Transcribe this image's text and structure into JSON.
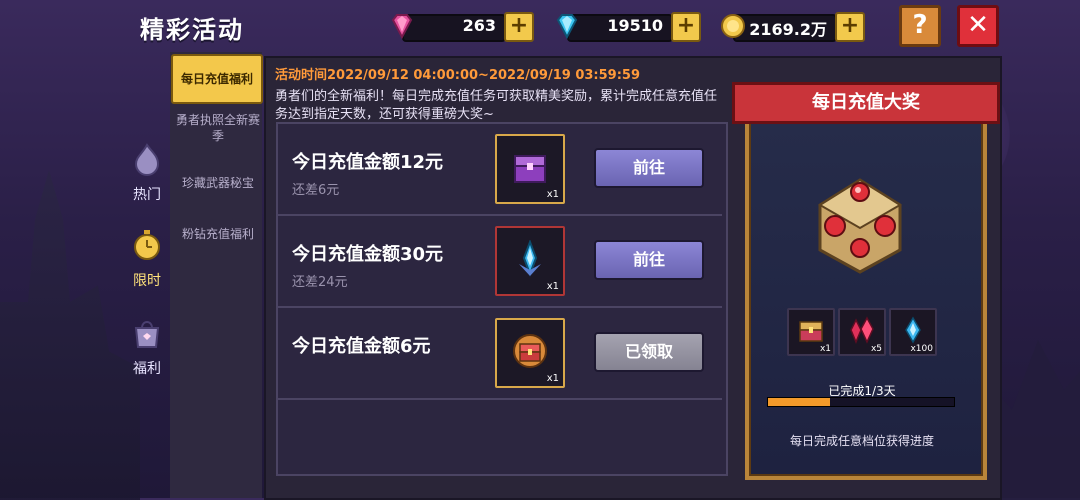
{
  "header": {
    "title": "精彩活动"
  },
  "currency": [
    {
      "name": "pink-gem",
      "value": "263",
      "color": "#e6529f"
    },
    {
      "name": "blue-gem",
      "value": "19510",
      "color": "#3cc6f2"
    },
    {
      "name": "gold-coin",
      "value": "2169.2万",
      "color": "#f2c94c"
    }
  ],
  "buttons": {
    "plus": "+",
    "help": "?",
    "close": "✕"
  },
  "categories": [
    {
      "label": "热门",
      "active": false
    },
    {
      "label": "限时",
      "active": true
    },
    {
      "label": "福利",
      "active": false
    }
  ],
  "tabs": [
    {
      "label": "每日充值福利",
      "active": true
    },
    {
      "label": "勇者执照全新赛季",
      "active": false
    },
    {
      "label": "珍藏武器秘宝",
      "active": false
    },
    {
      "label": "粉钻充值福利",
      "active": false
    }
  ],
  "event": {
    "time": "活动时间2022/09/12 04:00:00~2022/09/19 03:59:59",
    "description": "勇者们的全新福利！每日完成充值任务可获取精美奖励，累计完成任意充值任务达到指定天数，还可获得重磅大奖~"
  },
  "tasks": [
    {
      "title": "今日充值金额12元",
      "sub": "还差6元",
      "qty": "x1",
      "item": "purple-chest",
      "button": "前往",
      "state": "go"
    },
    {
      "title": "今日充值金额30元",
      "sub": "还差24元",
      "qty": "x1",
      "item": "blue-crystal-weapon",
      "button": "前往",
      "state": "go"
    },
    {
      "title": "今日充值金额6元",
      "sub": "",
      "qty": "x1",
      "item": "golden-chest",
      "button": "已领取",
      "state": "done"
    }
  ],
  "reward": {
    "title": "每日充值大奖",
    "items": [
      {
        "item": "treasure-chest",
        "qty": "x1"
      },
      {
        "item": "red-crystals",
        "qty": "x5"
      },
      {
        "item": "blue-crystal",
        "qty": "x100"
      }
    ],
    "progress_label": "已完成1/3天",
    "progress": 0.333,
    "footer": "每日完成任意档位获得进度"
  }
}
